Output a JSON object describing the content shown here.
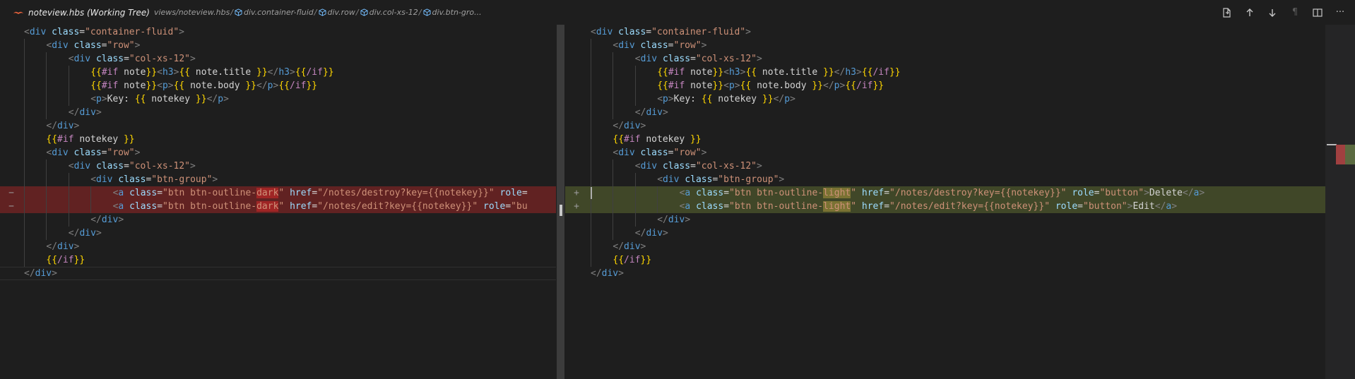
{
  "header": {
    "file_title": "noteview.hbs (Working Tree)",
    "breadcrumbs": [
      "views/noteview.hbs",
      "div.container-fluid",
      "div.row",
      "div.col-xs-12",
      "div.btn-gro..."
    ]
  },
  "actions": [
    {
      "name": "open-file-icon",
      "label": "open file"
    },
    {
      "name": "previous-change-icon",
      "label": "previous change"
    },
    {
      "name": "next-change-icon",
      "label": "next change"
    },
    {
      "name": "show-whitespace-icon",
      "label": "¶"
    },
    {
      "name": "split-editor-icon",
      "label": "split editor"
    },
    {
      "name": "more-actions-icon",
      "label": "···"
    }
  ],
  "left_pane": {
    "lines": [
      {
        "indent": 0,
        "text": "<div class=\"container-fluid\">"
      },
      {
        "indent": 1,
        "text": "<div class=\"row\">"
      },
      {
        "indent": 2,
        "text": "<div class=\"col-xs-12\">"
      },
      {
        "indent": 3,
        "text": "{{#if note}}<h3>{{ note.title }}</h3>{{/if}}"
      },
      {
        "indent": 3,
        "text": "{{#if note}}<p>{{ note.body }}</p>{{/if}}"
      },
      {
        "indent": 3,
        "text": "<p>Key: {{ notekey }}</p>"
      },
      {
        "indent": 2,
        "text": "</div>"
      },
      {
        "indent": 1,
        "text": "</div>"
      },
      {
        "indent": 1,
        "text": "{{#if notekey }}"
      },
      {
        "indent": 1,
        "text": "<div class=\"row\">"
      },
      {
        "indent": 2,
        "text": "<div class=\"col-xs-12\">"
      },
      {
        "indent": 3,
        "text": "<div class=\"btn-group\">"
      },
      {
        "indent": 4,
        "text": "<a class=\"btn btn-outline-dark\" href=\"/notes/destroy?key={{notekey}}\" role=",
        "marker": "−",
        "state": "removed"
      },
      {
        "indent": 4,
        "text": "<a class=\"btn btn-outline-dark\" href=\"/notes/edit?key={{notekey}}\" role=\"bu",
        "marker": "−",
        "state": "removed"
      },
      {
        "indent": 3,
        "text": "</div>"
      },
      {
        "indent": 2,
        "text": "</div>"
      },
      {
        "indent": 1,
        "text": "</div>"
      },
      {
        "indent": 1,
        "text": "{{/if}}"
      },
      {
        "indent": 0,
        "text": "</div>"
      }
    ]
  },
  "right_pane": {
    "lines": [
      {
        "indent": 0,
        "text": "<div class=\"container-fluid\">"
      },
      {
        "indent": 1,
        "text": "<div class=\"row\">"
      },
      {
        "indent": 2,
        "text": "<div class=\"col-xs-12\">"
      },
      {
        "indent": 3,
        "text": "{{#if note}}<h3>{{ note.title }}</h3>{{/if}}"
      },
      {
        "indent": 3,
        "text": "{{#if note}}<p>{{ note.body }}</p>{{/if}}"
      },
      {
        "indent": 3,
        "text": "<p>Key: {{ notekey }}</p>"
      },
      {
        "indent": 2,
        "text": "</div>"
      },
      {
        "indent": 1,
        "text": "</div>"
      },
      {
        "indent": 1,
        "text": "{{#if notekey }}"
      },
      {
        "indent": 1,
        "text": "<div class=\"row\">"
      },
      {
        "indent": 2,
        "text": "<div class=\"col-xs-12\">"
      },
      {
        "indent": 3,
        "text": "<div class=\"btn-group\">"
      },
      {
        "indent": 4,
        "text": "<a class=\"btn btn-outline-light\" href=\"/notes/destroy?key={{notekey}}\" role=\"button\">Delete</a>",
        "marker": "+",
        "state": "added"
      },
      {
        "indent": 4,
        "text": "<a class=\"btn btn-outline-light\" href=\"/notes/edit?key={{notekey}}\" role=\"button\">Edit</a>",
        "marker": "+",
        "state": "added"
      },
      {
        "indent": 3,
        "text": "</div>"
      },
      {
        "indent": 2,
        "text": "</div>"
      },
      {
        "indent": 1,
        "text": "</div>"
      },
      {
        "indent": 1,
        "text": "{{/if}}"
      },
      {
        "indent": 0,
        "text": "</div>"
      }
    ]
  },
  "colors": {
    "removed_bg": "#6b2222",
    "added_bg": "#3d4a1e",
    "tag": "#569cd6",
    "attr": "#9cdcfe",
    "string": "#ce9178",
    "handlebars": "#ffd700"
  }
}
